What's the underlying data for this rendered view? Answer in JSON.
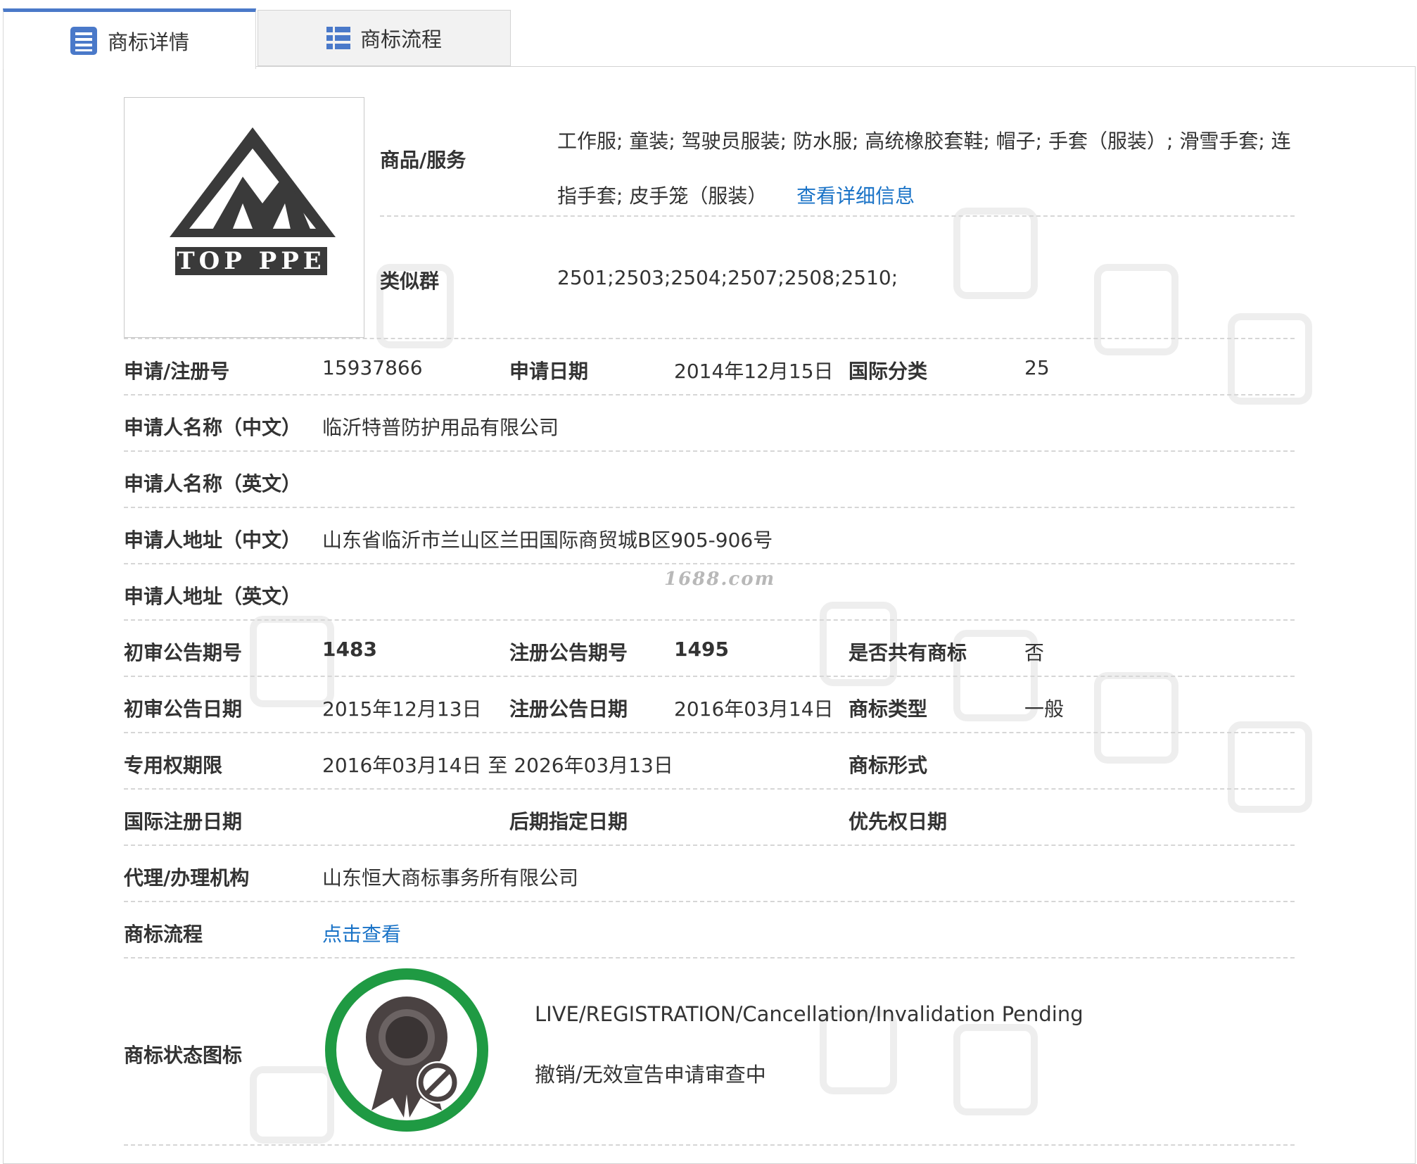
{
  "tabs": [
    {
      "label": "商标详情",
      "icon": "list-doc-icon",
      "active": true
    },
    {
      "label": "商标流程",
      "icon": "list-grid-icon",
      "active": false
    }
  ],
  "logo": {
    "text": "TOP PPE"
  },
  "goods": {
    "label": "商品/服务",
    "text": "工作服; 童装; 驾驶员服装; 防水服; 高统橡胶套鞋; 帽子; 手套（服装）; 滑雪手套; 连指手套; 皮手笼（服装）",
    "link": "查看详细信息"
  },
  "similar_group": {
    "label": "类似群",
    "value": "2501;2503;2504;2507;2508;2510;"
  },
  "rows": {
    "reg_no": {
      "label": "申请/注册号",
      "value": "15937866"
    },
    "apply_date": {
      "label": "申请日期",
      "value": "2014年12月15日"
    },
    "intl_class": {
      "label": "国际分类",
      "value": "25"
    },
    "applicant_cn": {
      "label": "申请人名称（中文）",
      "value": "临沂特普防护用品有限公司"
    },
    "applicant_en": {
      "label": "申请人名称（英文）",
      "value": ""
    },
    "address_cn": {
      "label": "申请人地址（中文）",
      "value": "山东省临沂市兰山区兰田国际商贸城B区905-906号"
    },
    "address_en": {
      "label": "申请人地址（英文）",
      "value": ""
    },
    "prelim_issue": {
      "label": "初审公告期号",
      "value": "1483"
    },
    "reg_issue": {
      "label": "注册公告期号",
      "value": "1495"
    },
    "shared": {
      "label": "是否共有商标",
      "value": "否"
    },
    "prelim_date": {
      "label": "初审公告日期",
      "value": "2015年12月13日"
    },
    "reg_date": {
      "label": "注册公告日期",
      "value": "2016年03月14日"
    },
    "tm_type": {
      "label": "商标类型",
      "value": "一般"
    },
    "exclusive_period": {
      "label": "专用权期限",
      "value": "2016年03月14日 至 2026年03月13日"
    },
    "tm_form": {
      "label": "商标形式",
      "value": ""
    },
    "intl_reg_date": {
      "label": "国际注册日期",
      "value": ""
    },
    "later_date": {
      "label": "后期指定日期",
      "value": ""
    },
    "priority_date": {
      "label": "优先权日期",
      "value": ""
    },
    "agent": {
      "label": "代理/办理机构",
      "value": "山东恒大商标事务所有限公司"
    },
    "process": {
      "label": "商标流程",
      "value": "点击查看"
    }
  },
  "status": {
    "label": "商标状态图标",
    "en": "LIVE/REGISTRATION/Cancellation/Invalidation Pending",
    "cn": "撤销/无效宣告申请审查中",
    "ring_color": "#1f9a43"
  },
  "watermark": {
    "site": "1688.com"
  },
  "colors": {
    "accent": "#4a79c9",
    "link": "#1a73c7",
    "prev_arrow": "#f7941d",
    "next_arrow": "#5b9bd5"
  }
}
